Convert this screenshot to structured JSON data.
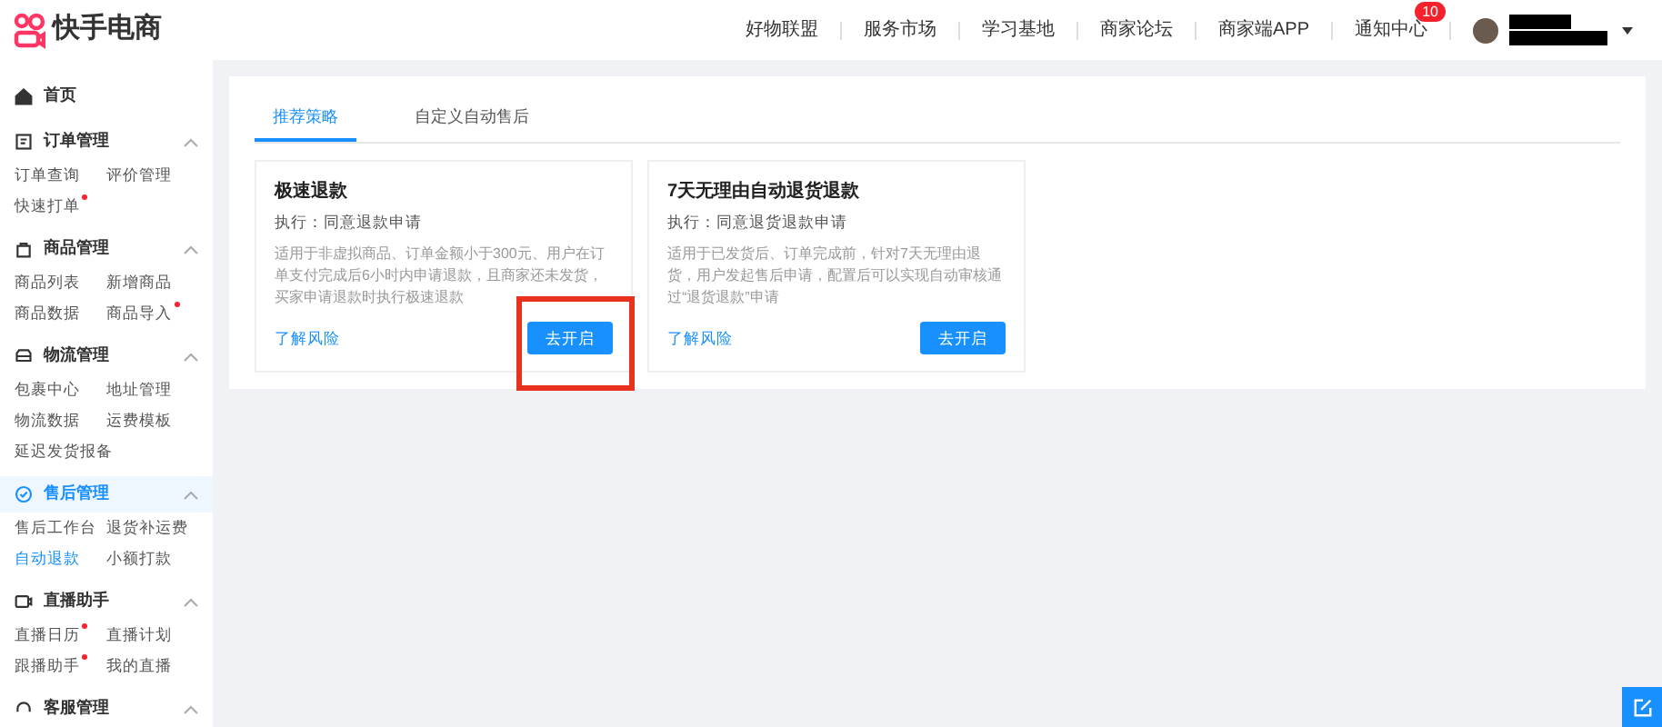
{
  "header": {
    "logo_text": "快手电商",
    "nav": [
      {
        "label": "好物联盟"
      },
      {
        "label": "服务市场"
      },
      {
        "label": "学习基地"
      },
      {
        "label": "商家论坛"
      },
      {
        "label": "商家端APP"
      },
      {
        "label": "通知中心",
        "badge": "10"
      }
    ]
  },
  "sidebar": {
    "home": {
      "label": "首页"
    },
    "groups": [
      {
        "label": "订单管理",
        "expanded": true,
        "selected": false,
        "items": [
          {
            "label": "订单查询",
            "selected": false,
            "new": false
          },
          {
            "label": "评价管理",
            "selected": false,
            "new": false
          },
          {
            "label": "快速打单",
            "selected": false,
            "new": true
          }
        ]
      },
      {
        "label": "商品管理",
        "expanded": true,
        "selected": false,
        "items": [
          {
            "label": "商品列表",
            "selected": false,
            "new": false
          },
          {
            "label": "新增商品",
            "selected": false,
            "new": false
          },
          {
            "label": "商品数据",
            "selected": false,
            "new": false
          },
          {
            "label": "商品导入",
            "selected": false,
            "new": true
          }
        ]
      },
      {
        "label": "物流管理",
        "expanded": true,
        "selected": false,
        "items": [
          {
            "label": "包裹中心",
            "selected": false,
            "new": false
          },
          {
            "label": "地址管理",
            "selected": false,
            "new": false
          },
          {
            "label": "物流数据",
            "selected": false,
            "new": false
          },
          {
            "label": "运费模板",
            "selected": false,
            "new": false
          },
          {
            "label": "延迟发货报备",
            "selected": false,
            "new": false
          }
        ]
      },
      {
        "label": "售后管理",
        "expanded": true,
        "selected": true,
        "items": [
          {
            "label": "售后工作台",
            "selected": false,
            "new": false
          },
          {
            "label": "退货补运费",
            "selected": false,
            "new": false
          },
          {
            "label": "自动退款",
            "selected": true,
            "new": false
          },
          {
            "label": "小额打款",
            "selected": false,
            "new": false
          }
        ]
      },
      {
        "label": "直播助手",
        "expanded": true,
        "selected": false,
        "items": [
          {
            "label": "直播日历",
            "selected": false,
            "new": true
          },
          {
            "label": "直播计划",
            "selected": false,
            "new": false
          },
          {
            "label": "跟播助手",
            "selected": false,
            "new": true
          },
          {
            "label": "我的直播",
            "selected": false,
            "new": false
          }
        ]
      },
      {
        "label": "客服管理",
        "expanded": true,
        "selected": false
      }
    ]
  },
  "tabs": [
    {
      "label": "推荐策略",
      "selected": true
    },
    {
      "label": "自定义自动售后",
      "selected": false
    }
  ],
  "cards": [
    {
      "title": "极速退款",
      "action": "执行：同意退款申请",
      "description": "适用于非虚拟商品、订单金额小于300元、用户在订单支付完成后6小时内申请退款，且商家还未发货，买家申请退款时执行极速退款",
      "link": "了解风险",
      "button": "去开启",
      "highlighted": true
    },
    {
      "title": "7天无理由自动退货退款",
      "action": "执行：同意退货退款申请",
      "description": "适用于已发货后、订单完成前，针对7天无理由退货，用户发起售后申请，配置后可以实现自动审核通过“退货退款”申请",
      "link": "了解风险",
      "button": "去开启",
      "highlighted": false
    }
  ]
}
